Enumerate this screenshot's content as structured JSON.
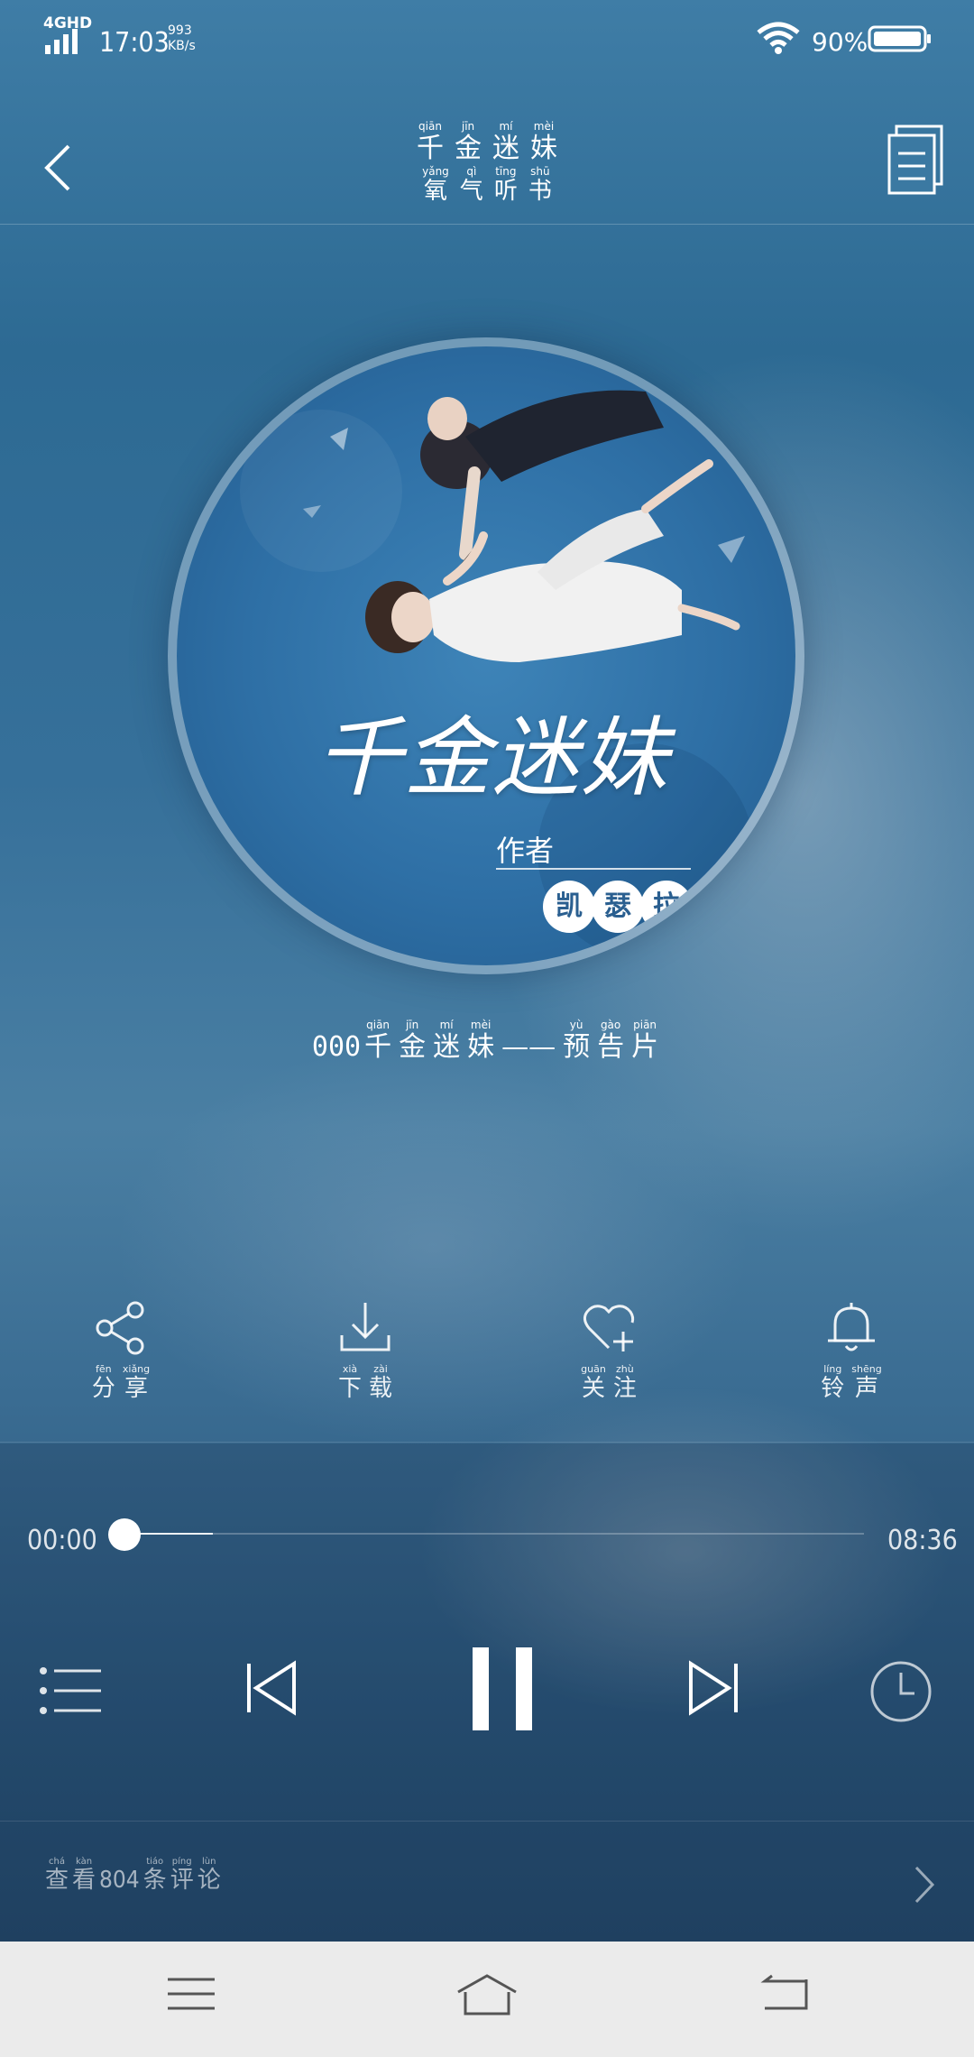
{
  "status_bar": {
    "network": "4GHD",
    "time": "17:03",
    "speed_value": "993",
    "speed_unit": "KB/s",
    "battery_percent": "90%"
  },
  "header": {
    "title": [
      {
        "char": "千",
        "pinyin": "qiān"
      },
      {
        "char": "金",
        "pinyin": "jīn"
      },
      {
        "char": "迷",
        "pinyin": "mí"
      },
      {
        "char": "妹",
        "pinyin": "mèi"
      }
    ],
    "subtitle": [
      {
        "char": "氧",
        "pinyin": "yǎng"
      },
      {
        "char": "气",
        "pinyin": "qì"
      },
      {
        "char": "听",
        "pinyin": "tīng"
      },
      {
        "char": "书",
        "pinyin": "shū"
      }
    ]
  },
  "cover": {
    "title": "千金迷妹",
    "author_label": "作者",
    "author_name": [
      "凯",
      "瑟",
      "拉"
    ]
  },
  "track": {
    "number": "000",
    "name": [
      {
        "char": "千",
        "pinyin": "qiān"
      },
      {
        "char": "金",
        "pinyin": "jīn"
      },
      {
        "char": "迷",
        "pinyin": "mí"
      },
      {
        "char": "妹",
        "pinyin": "mèi"
      },
      {
        "char": "——",
        "pinyin": ""
      },
      {
        "char": "预",
        "pinyin": "yù"
      },
      {
        "char": "告",
        "pinyin": "gào"
      },
      {
        "char": "片",
        "pinyin": "piān"
      }
    ]
  },
  "actions": {
    "share": [
      {
        "char": "分",
        "pinyin": "fēn"
      },
      {
        "char": "享",
        "pinyin": "xiǎng"
      }
    ],
    "download": [
      {
        "char": "下",
        "pinyin": "xià"
      },
      {
        "char": "载",
        "pinyin": "zài"
      }
    ],
    "follow": [
      {
        "char": "关",
        "pinyin": "guān"
      },
      {
        "char": "注",
        "pinyin": "zhù"
      }
    ],
    "ringtone": [
      {
        "char": "铃",
        "pinyin": "líng"
      },
      {
        "char": "声",
        "pinyin": "shēng"
      }
    ]
  },
  "player": {
    "current_time": "00:00",
    "total_time": "08:36",
    "progress_fraction": 0.0,
    "buffered_fraction": 0.12,
    "state": "playing"
  },
  "comments": {
    "prefix": [
      {
        "char": "查",
        "pinyin": "chá"
      },
      {
        "char": "看",
        "pinyin": "kàn"
      }
    ],
    "count": "804",
    "suffix": [
      {
        "char": "条",
        "pinyin": "tiáo"
      },
      {
        "char": "评",
        "pinyin": "píng"
      },
      {
        "char": "论",
        "pinyin": "lùn"
      }
    ]
  },
  "icons": {
    "back": "chevron-left-icon",
    "playlist_doc": "document-icon",
    "share": "share-icon",
    "download": "download-icon",
    "follow": "heart-plus-icon",
    "ringtone": "bell-icon",
    "list": "list-icon",
    "prev": "skip-previous-icon",
    "pause": "pause-icon",
    "next": "skip-next-icon",
    "timer": "clock-icon",
    "comments_arrow": "chevron-right-icon"
  }
}
